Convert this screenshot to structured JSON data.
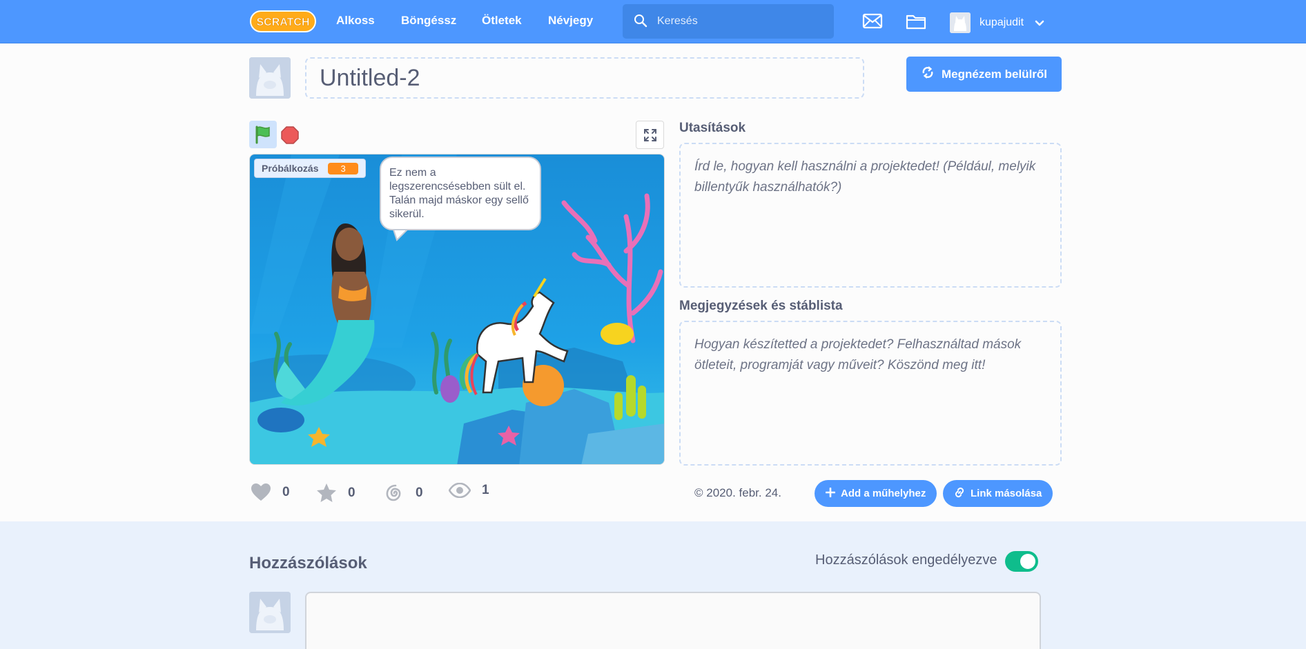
{
  "nav": {
    "logo_text": "SCRATCH",
    "links": [
      "Alkoss",
      "Böngéssz",
      "Ötletek",
      "Névjegy"
    ],
    "search_placeholder": "Keresés",
    "username": "kupajudit",
    "icons": [
      "messages-icon",
      "my-stuff-folder-icon",
      "chevron-down-icon"
    ]
  },
  "project": {
    "title": "Untitled-2",
    "see_inside_label": "Megnézem belülről"
  },
  "stage": {
    "monitor_label": "Próbálkozás",
    "monitor_value": "3",
    "speech_bubble": "Ez nem a legszerencsésebben sült el. Talán majd máskor egy sellő sikerül."
  },
  "stats": {
    "loves": "0",
    "favorites": "0",
    "remixes": "0",
    "views": "1"
  },
  "instructions": {
    "title": "Utasítások",
    "placeholder": "Írd le, hogyan kell használni a projektedet! (Például, melyik billentyűk használhatók?)"
  },
  "notes": {
    "title": "Megjegyzések és stáblista",
    "placeholder": "Hogyan készítetted a projektedet? Felhasználtad mások ötleteit, programját vagy műveit? Köszönd meg itt!"
  },
  "footer_row": {
    "date": "2020. febr. 24.",
    "add_studio_label": "Add a műhelyhez",
    "copy_link_label": "Link másolása"
  },
  "comments": {
    "title": "Hozzászólások",
    "toggle_label": "Hozzászólások engedélyezve",
    "enabled": true
  },
  "colors": {
    "nav_blue": "#4d97ff",
    "text": "#575e75",
    "monitor_orange": "#ff8c1a",
    "toggle_green": "#0fbd8c",
    "comments_bg": "#e9f1fc"
  }
}
